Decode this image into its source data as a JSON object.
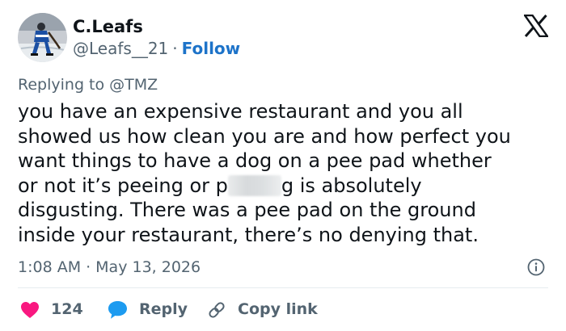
{
  "author": {
    "display_name": "C.Leafs",
    "handle": "@Leafs__21",
    "follow_label": "Follow",
    "separator": "·"
  },
  "reply": {
    "prefix": "Replying to",
    "mention": "@TMZ"
  },
  "tweet": {
    "lines": [
      "you have an expensive restaurant and you all",
      "showed us how clean you are and how perfect you",
      "want things to have a dog on a pee pad whether",
      "",
      "disgusting. There was a pee pad on the ground",
      "inside your restaurant, there’s no denying that."
    ],
    "line4_before": "or not it’s peeing or p",
    "line4_after": "g is absolutely"
  },
  "meta": {
    "time": "1:08 AM",
    "separator": "·",
    "date": "May 13, 2026"
  },
  "actions": {
    "like_count": "124",
    "reply_label": "Reply",
    "copy_label": "Copy link"
  },
  "icons": {
    "brand": "x-logo-icon",
    "info": "info-icon",
    "like": "heart-icon",
    "reply": "speech-bubble-icon",
    "copy": "link-icon"
  },
  "colors": {
    "text": "#0f1419",
    "secondary": "#536471",
    "follow": "#1d73c9",
    "like": "#f91880",
    "reply_icon": "#1d9bf0",
    "divider": "#e6ecf0"
  }
}
